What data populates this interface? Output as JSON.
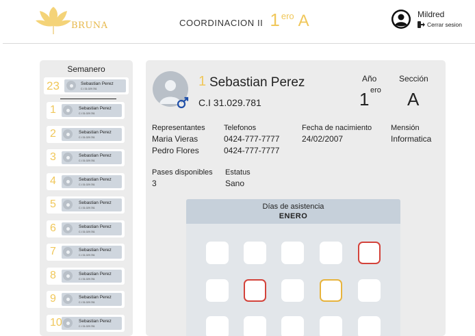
{
  "header": {
    "logo_text": "BRUNA",
    "coord_label": "COORDINACION II",
    "grade": "1",
    "grade_sup": "ero",
    "section": "A",
    "user_name": "Mildred",
    "logout_label": "Cerrar sesion"
  },
  "sidebar": {
    "title": "Semanero",
    "weekly": {
      "number": "23",
      "name": "Sebastian Perez",
      "ci": "C.I 31.029.781"
    },
    "students": [
      {
        "number": "1",
        "name": "Sebastian Perez",
        "ci": "C.I 31.029.781"
      },
      {
        "number": "2",
        "name": "Sebastian Perez",
        "ci": "C.I 31.029.781"
      },
      {
        "number": "3",
        "name": "Sebastian Perez",
        "ci": "C.I 31.029.781"
      },
      {
        "number": "4",
        "name": "Sebastian Perez",
        "ci": "C.I 31.029.781"
      },
      {
        "number": "5",
        "name": "Sebastian Perez",
        "ci": "C.I 31.029.781"
      },
      {
        "number": "6",
        "name": "Sebastian Perez",
        "ci": "C.I 31.029.781"
      },
      {
        "number": "7",
        "name": "Sebastian Perez",
        "ci": "C.I 31.029.781"
      },
      {
        "number": "8",
        "name": "Sebastian Perez",
        "ci": "C.I 31.029.781"
      },
      {
        "number": "9",
        "name": "Sebastian Perez",
        "ci": "C.I 31.029.781"
      },
      {
        "number": "10",
        "name": "Sebastian Perez",
        "ci": "C.I 31.029.781"
      }
    ]
  },
  "profile": {
    "number": "1",
    "name": "Sebastian Perez",
    "ci": "C.I 31.029.781",
    "year_label": "Año",
    "year_value": "1",
    "year_sup": "ero",
    "section_label": "Sección",
    "section_value": "A",
    "representantes_label": "Representantes",
    "representantes": [
      "Maria Vieras",
      "Pedro Flores"
    ],
    "telefonos_label": "Telefonos",
    "telefonos": [
      "0424-777-7777",
      "0424-777-7777"
    ],
    "fecha_label": "Fecha de nacimiento",
    "fecha_value": "24/02/2007",
    "mension_label": "Mensión",
    "mension_value": "Informatica",
    "pases_label": "Pases disponibles",
    "pases_value": "3",
    "estatus_label": "Estatus",
    "estatus_value": "Sano"
  },
  "attendance": {
    "title": "Días de asistencia",
    "month": "ENERO",
    "rows": [
      [
        "normal",
        "normal",
        "normal",
        "normal",
        "red"
      ],
      [
        "normal",
        "red",
        "normal",
        "yellow",
        "normal"
      ],
      [
        "normal",
        "normal",
        "normal",
        "normal",
        "normal"
      ]
    ]
  },
  "colors": {
    "accent_yellow": "#f0c75a",
    "absent_red": "#d3423a",
    "late_yellow": "#e7b33c",
    "card_blue": "#cfd6de"
  }
}
